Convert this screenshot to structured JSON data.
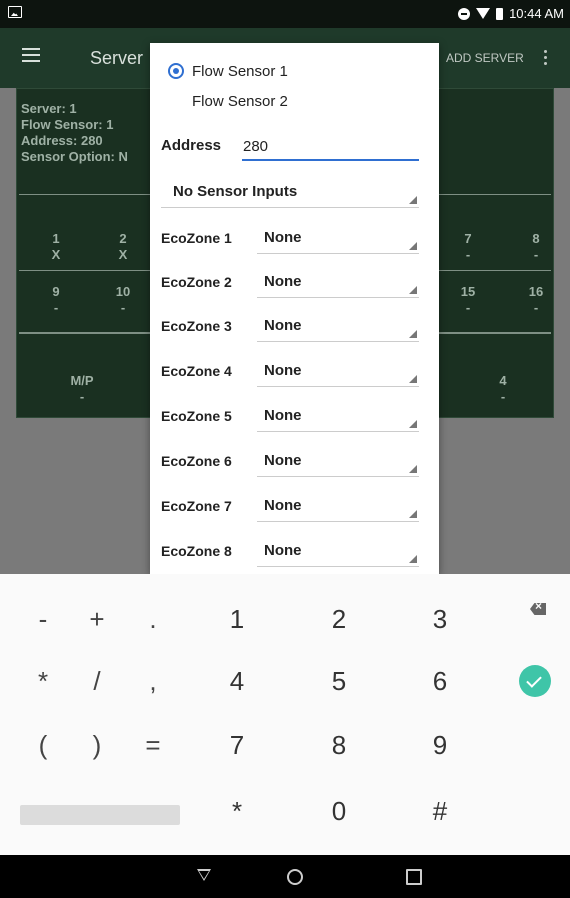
{
  "status_bar": {
    "time": "10:44 AM",
    "icons": [
      "image-icon",
      "do-not-disturb-icon",
      "wifi-icon",
      "battery-icon"
    ]
  },
  "app_bar": {
    "title": "Server",
    "add_server": "ADD SERVER"
  },
  "info_panel": {
    "lines": [
      "Server: 1",
      "Flow Sensor: 1",
      "Address: 280",
      "Sensor Option: N"
    ],
    "row1": [
      {
        "label": "1",
        "value": "X"
      },
      {
        "label": "2",
        "value": "X"
      },
      {
        "label": "7",
        "value": "-"
      },
      {
        "label": "8",
        "value": "-"
      }
    ],
    "row2": [
      {
        "label": "9",
        "value": "-"
      },
      {
        "label": "10",
        "value": "-"
      },
      {
        "label": "15",
        "value": "-"
      },
      {
        "label": "16",
        "value": "-"
      }
    ],
    "row3": [
      {
        "label": "M/P",
        "value": "-"
      },
      {
        "label": "4",
        "value": "-"
      }
    ]
  },
  "dialog": {
    "radio_options": [
      {
        "label": "Flow Sensor 1",
        "selected": true
      },
      {
        "label": "Flow Sensor 2",
        "selected": false
      }
    ],
    "address_label": "Address",
    "address_value": "280",
    "sensor_input": "No Sensor Inputs",
    "ecozones": [
      {
        "label": "EcoZone 1",
        "value": "None"
      },
      {
        "label": "EcoZone 2",
        "value": "None"
      },
      {
        "label": "EcoZone 3",
        "value": "None"
      },
      {
        "label": "EcoZone 4",
        "value": "None"
      },
      {
        "label": "EcoZone 5",
        "value": "None"
      },
      {
        "label": "EcoZone 6",
        "value": "None"
      },
      {
        "label": "EcoZone 7",
        "value": "None"
      },
      {
        "label": "EcoZone 8",
        "value": "None"
      }
    ]
  },
  "keyboard": {
    "rows": [
      [
        "-",
        "+",
        ".",
        "1",
        "2",
        "3"
      ],
      [
        "*",
        "/",
        ",",
        "4",
        "5",
        "6"
      ],
      [
        "(",
        ")",
        "=",
        "7",
        "8",
        "9"
      ],
      [
        "*",
        "0",
        "#"
      ]
    ],
    "accent": "#3fc5a8"
  },
  "colors": {
    "app_bar": "#1f3a2a",
    "info_panel": "#1a3021",
    "accent": "#2f6fd1"
  }
}
